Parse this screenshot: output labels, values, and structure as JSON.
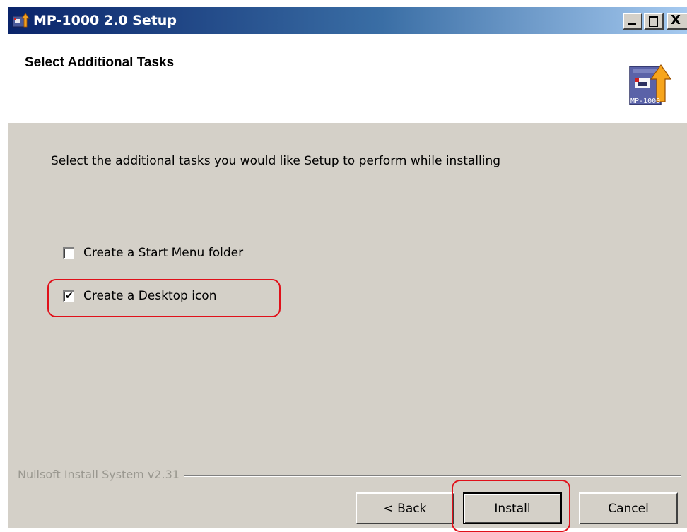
{
  "window": {
    "title": "MP-1000 2.0 Setup",
    "controls": {
      "minimize": "minimize-icon",
      "maximize": "maximize-icon",
      "close": "close-icon",
      "close_glyph": "X"
    }
  },
  "header": {
    "title": "Select Additional Tasks",
    "logo_text": "MP-1000"
  },
  "body": {
    "instruction": "Select the additional tasks you would like Setup to perform while installing",
    "tasks": [
      {
        "label": "Create a Start Menu folder",
        "checked": false
      },
      {
        "label": "Create a Desktop icon",
        "checked": true
      }
    ]
  },
  "branding": "Nullsoft Install System v2.31",
  "buttons": {
    "back": "< Back",
    "install": "Install",
    "cancel": "Cancel"
  },
  "colors": {
    "titlebar_start": "#0a246a",
    "titlebar_end": "#a6caf0",
    "dialog_bg": "#d4d0c8",
    "annotation": "#e0101a"
  }
}
